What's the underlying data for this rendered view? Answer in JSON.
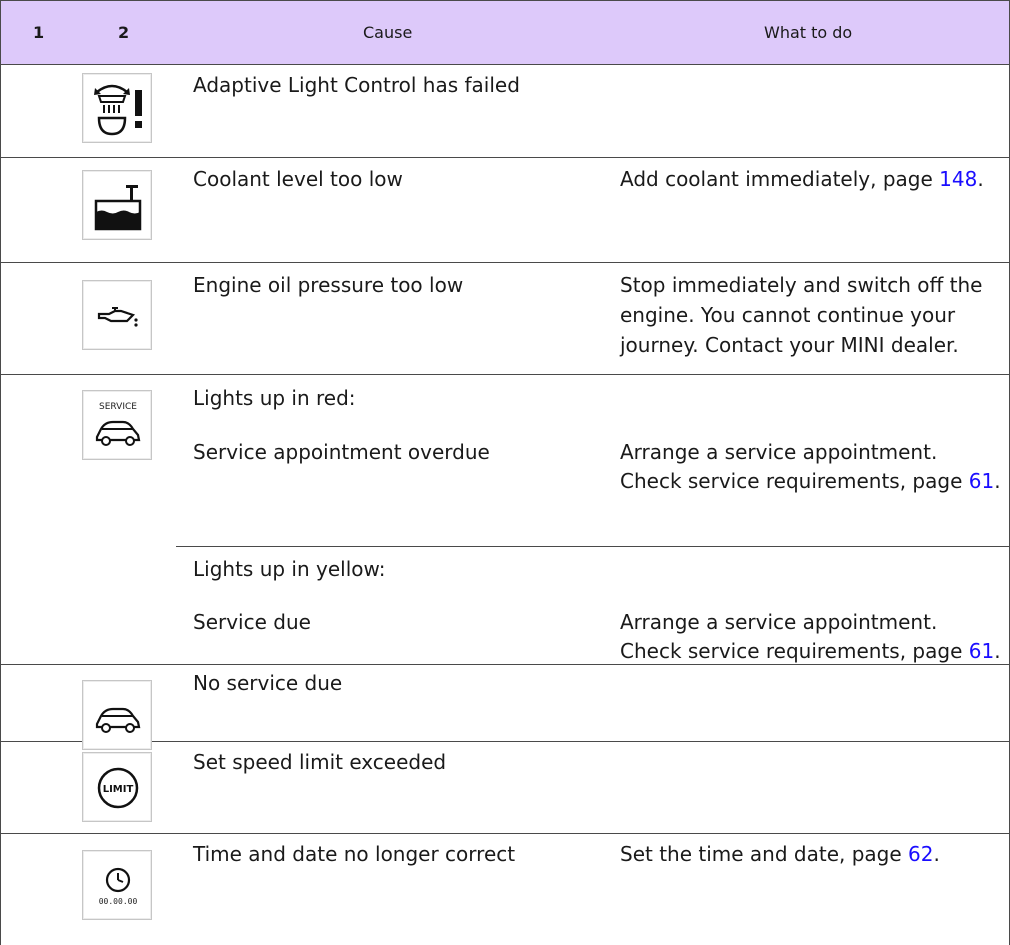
{
  "header": {
    "col1": "1",
    "col2": "2",
    "col3": "Cause",
    "col4": "What to do"
  },
  "rows": [
    {
      "icon": "adaptive-light-icon",
      "cause": "Adaptive Light Control has failed"
    },
    {
      "icon": "coolant-icon",
      "cause": "Coolant level too low",
      "action_text": "Add coolant immediately, page ",
      "action_link": "148",
      "action_end": "."
    },
    {
      "icon": "oil-pressure-icon",
      "cause": "Engine oil pressure too low",
      "action_lines": [
        "Stop immediately and switch off the",
        "engine. You cannot continue your",
        "journey. Contact your MINI dealer."
      ]
    },
    {
      "icon": "service-icon",
      "icon_label": "SERVICE",
      "sub1_heading": "Lights up in red:",
      "sub1_cause": "Service appointment overdue",
      "sub1_action_line1": "Arrange a service appointment.",
      "sub1_action_line2": "Check service requirements, page ",
      "sub1_action_link": "61",
      "sub1_action_end": ".",
      "sub2_heading": "Lights up in yellow:",
      "sub2_cause": "Service due",
      "sub2_action_line1": "Arrange a service appointment.",
      "sub2_action_line2": "Check service requirements, page ",
      "sub2_action_link": "61",
      "sub2_action_end": "."
    },
    {
      "icon": "car-icon",
      "cause": "No service due"
    },
    {
      "icon": "limit-icon",
      "icon_label": "LIMIT",
      "cause": "Set speed limit exceeded"
    },
    {
      "icon": "clock-icon",
      "icon_label": "00.00.00",
      "cause": "Time and date no longer correct",
      "action_text": "Set the time and date, page ",
      "action_link": "62",
      "action_end": "."
    }
  ]
}
